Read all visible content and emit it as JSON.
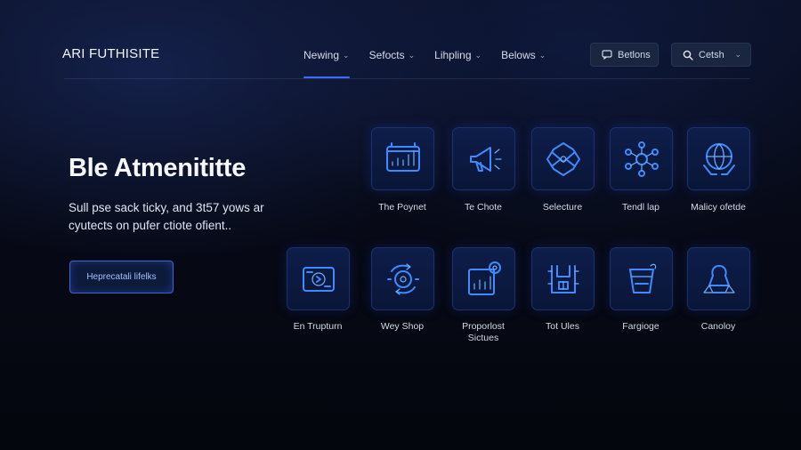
{
  "header": {
    "brand": "ARI FUTHISITE",
    "nav": [
      {
        "label": "Newing",
        "chevron": "⌄"
      },
      {
        "label": "Sefocts",
        "chevron": "⌄"
      },
      {
        "label": "Lihpling",
        "chevron": "⌄"
      },
      {
        "label": "Belows",
        "chevron": "⌄"
      }
    ],
    "bellows_button": "Betlons",
    "search_button": "Cetsh"
  },
  "hero": {
    "title": "Ble Atmenititte",
    "text": "Sull pse sack ticky, and 3t57 yows ar cyutects on pufer ctiote ofient..",
    "cta": "Heprecatali lifelks"
  },
  "tiles": [
    {
      "label": "The Poynet",
      "icon": "dashboard-chart-icon"
    },
    {
      "label": "Te Chote",
      "icon": "megaphone-icon"
    },
    {
      "label": "Selecture",
      "icon": "envelope-gem-icon"
    },
    {
      "label": "Tendl lap",
      "icon": "network-hub-icon"
    },
    {
      "label": "Malicy ofetde",
      "icon": "globe-hands-icon"
    },
    {
      "label": "En Trupturn",
      "icon": "card-disc-icon"
    },
    {
      "label": "Wey Shop",
      "icon": "rotate-disc-icon"
    },
    {
      "label": "Proporlost Sictues",
      "icon": "bar-chart-target-icon"
    },
    {
      "label": "Tot Ules",
      "icon": "box-arrows-icon"
    },
    {
      "label": "Fargioge",
      "icon": "cup-icon"
    },
    {
      "label": "Canoloy",
      "icon": "triangle-nodes-icon"
    }
  ],
  "colors": {
    "accent": "#3d8bff",
    "tile_bg": "#0e1d4a",
    "background": "#05070f"
  }
}
